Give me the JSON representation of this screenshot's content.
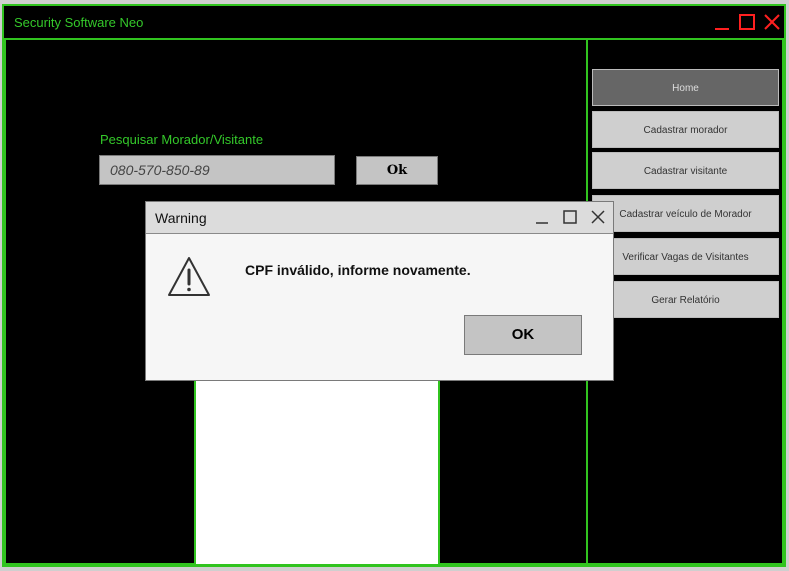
{
  "window": {
    "title": "Security Software Neo",
    "controls": {
      "minimize_icon": "minimize-icon",
      "maximize_icon": "maximize-icon",
      "close_icon": "close-icon",
      "color": "#ff2020"
    }
  },
  "search": {
    "label": "Pesquisar Morador/Visitante",
    "value": "080-570-850-89",
    "ok_label": "Ok"
  },
  "sidebar": {
    "items": [
      {
        "label": "Home",
        "active": true
      },
      {
        "label": "Cadastrar morador",
        "active": false
      },
      {
        "label": "Cadastrar visitante",
        "active": false
      },
      {
        "label": "Cadastrar veículo de Morador",
        "active": false
      },
      {
        "label": "Verificar Vagas de Visitantes",
        "active": false
      },
      {
        "label": "Gerar Relatório",
        "active": false
      }
    ]
  },
  "dialog": {
    "title": "Warning",
    "message": "CPF inválido, informe novamente.",
    "ok_label": "OK",
    "icon": "warning-icon"
  },
  "colors": {
    "accent": "#31c41f",
    "background": "#000000",
    "window_controls": "#ff2020"
  }
}
